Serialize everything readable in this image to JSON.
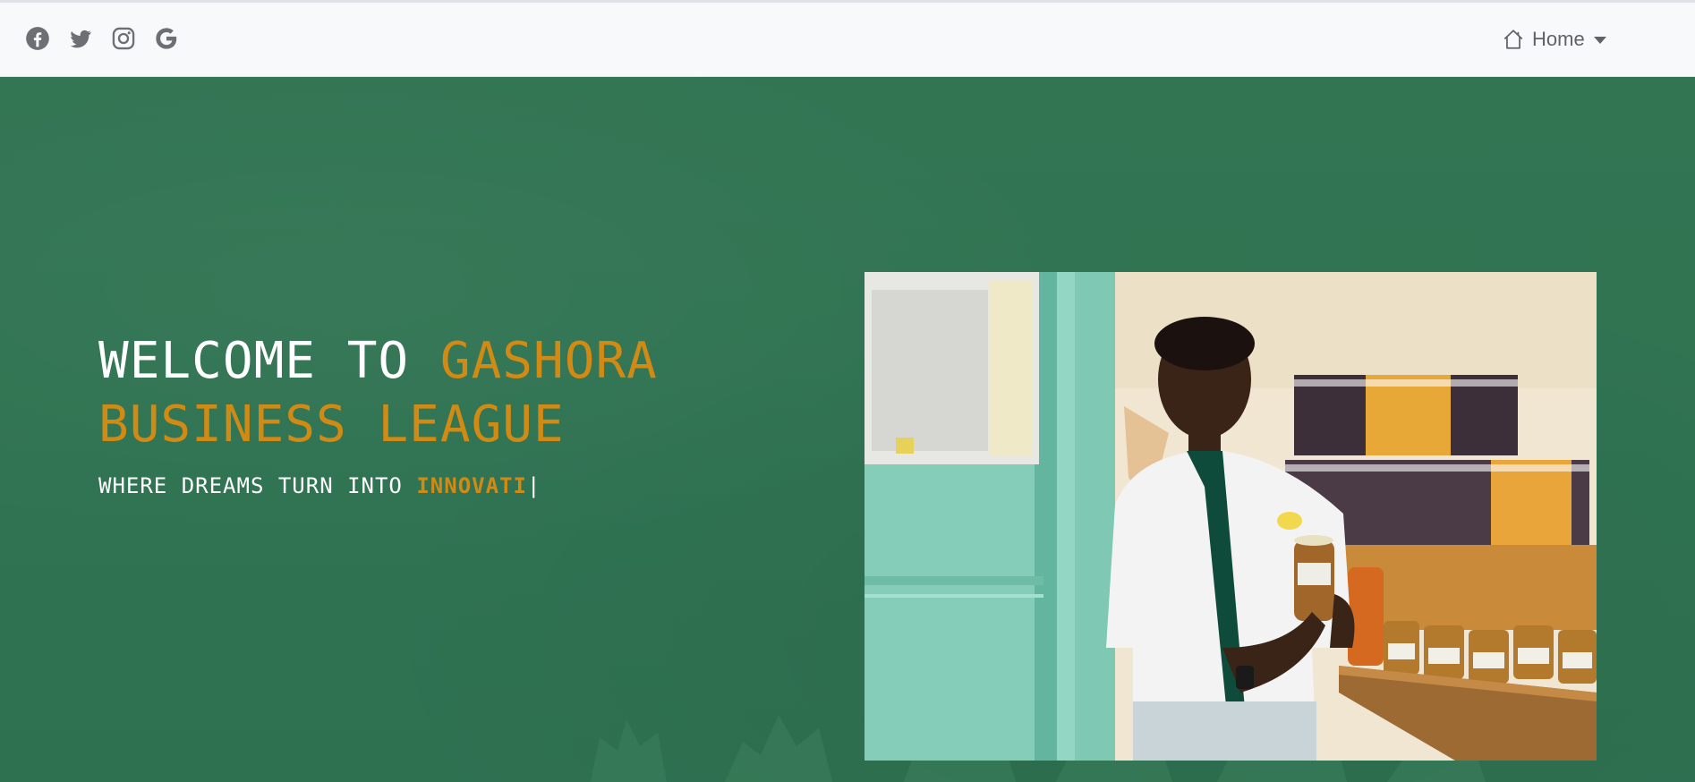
{
  "header": {
    "social_icons": [
      "facebook-icon",
      "twitter-icon",
      "instagram-icon",
      "google-icon"
    ],
    "nav": {
      "home_label": "Home",
      "home_icon": "house-icon"
    }
  },
  "hero": {
    "title_white": "WELCOME TO ",
    "title_accent_line1": "GASHORA",
    "title_accent_line2": "BUSINESS LEAGUE",
    "tagline_prefix": "WHERE DREAMS TURN INTO ",
    "tagline_typed": "INNOVATI",
    "tagline_cursor": "|"
  },
  "colors": {
    "hero_green": "#327553",
    "accent_orange": "#d18a14",
    "navbar_bg": "#f8f9fa",
    "icon_gray": "#6c6f73"
  }
}
